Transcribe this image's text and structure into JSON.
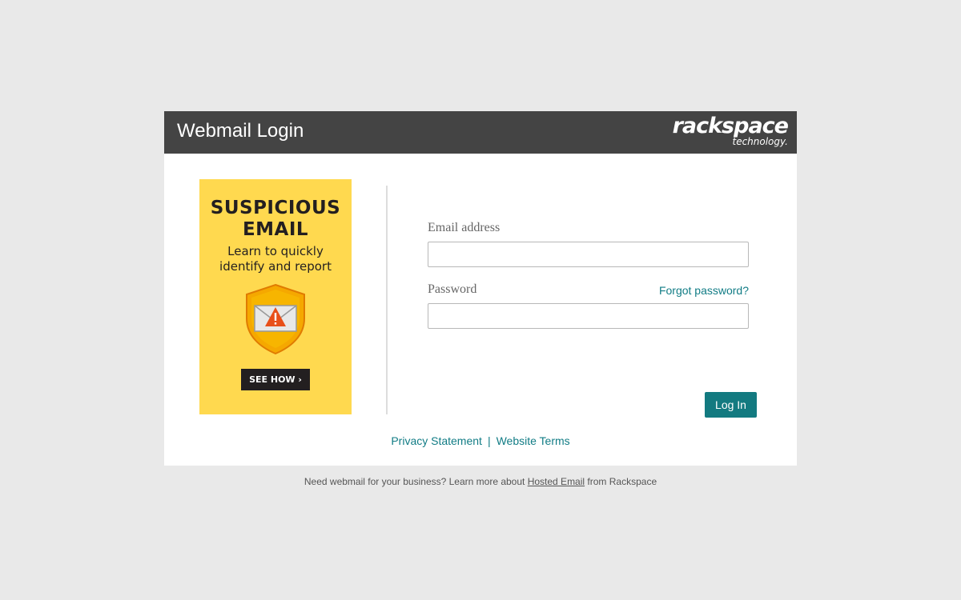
{
  "header": {
    "title": "Webmail Login",
    "logo_main": "rackspace",
    "logo_sub": "technology."
  },
  "ad": {
    "headline_line1": "SUSPICIOUS",
    "headline_line2": "EMAIL",
    "sub_line1": "Learn to quickly",
    "sub_line2": "identify and report",
    "cta": "SEE HOW ›",
    "icon": "shield-envelope-warning-icon"
  },
  "form": {
    "email_label": "Email address",
    "email_value": "",
    "password_label": "Password",
    "password_value": "",
    "forgot_link": "Forgot password?",
    "login_button": "Log In"
  },
  "footer": {
    "privacy": "Privacy Statement",
    "separator": "|",
    "terms": "Website Terms"
  },
  "bottom_note": {
    "prefix": "Need webmail for your business? Learn more about",
    "link": "Hosted Email",
    "suffix": "from Rackspace"
  },
  "colors": {
    "page_bg": "#e9e9e9",
    "header_bg": "#444444",
    "accent_teal": "#137a80",
    "ad_yellow": "#ffd94f"
  }
}
